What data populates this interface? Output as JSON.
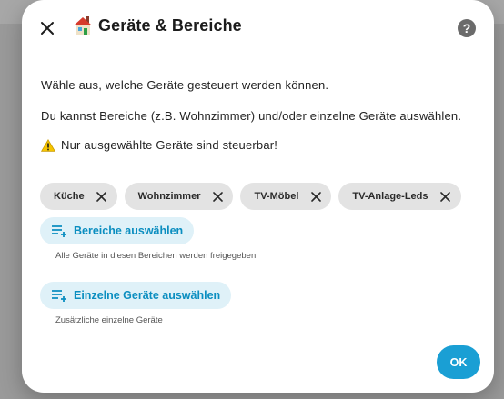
{
  "dialog": {
    "title": "Geräte & Bereiche",
    "help_label": "?",
    "intro_line1": "Wähle aus, welche Geräte gesteuert werden können.",
    "intro_line2": "Du kannst Bereiche (z.B. Wohnzimmer) und/oder einzelne Geräte auswählen.",
    "warning": "Nur ausgewählte Geräte sind steuerbar!",
    "chips": [
      {
        "label": "Küche"
      },
      {
        "label": "Wohnzimmer"
      },
      {
        "label": "TV-Möbel"
      },
      {
        "label": "TV-Anlage-Leds"
      }
    ],
    "areas_button": "Bereiche auswählen",
    "areas_hint": "Alle Geräte in diesen Bereichen werden freigegeben",
    "devices_button": "Einzelne Geräte auswählen",
    "devices_hint": "Zusätzliche einzelne Geräte",
    "ok_button": "OK"
  },
  "icons": {
    "close": "close-icon",
    "title": "house-icon",
    "help": "help-icon",
    "warning": "warning-icon",
    "chip_remove": "close-icon",
    "add_list": "playlist-add-icon"
  },
  "colors": {
    "accent": "#1a9fd4",
    "accent_text": "#0b8ec0",
    "pill_bg": "#dff1f8",
    "chip_bg": "#e3e3e3",
    "warning": "#f5c400"
  }
}
